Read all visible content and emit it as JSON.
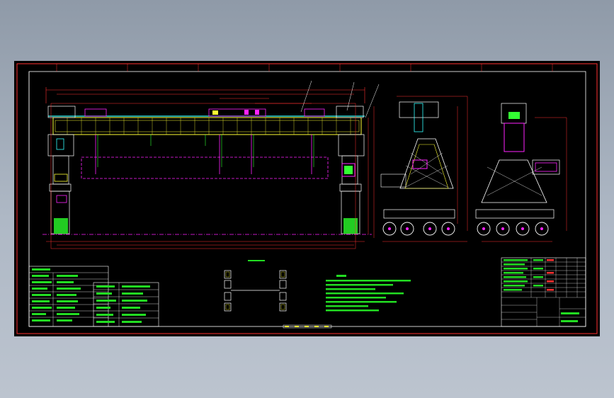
{
  "drawing": {
    "center_title": "",
    "notes_title": "",
    "bottom_label": "",
    "scale": "",
    "left_table_rows": [
      "",
      "",
      "",
      "",
      "",
      "",
      "",
      "",
      ""
    ],
    "mid_table_rows": [
      "",
      "",
      "",
      "",
      "",
      ""
    ],
    "notes_lines": [
      "",
      "",
      "",
      "",
      "",
      ""
    ],
    "title_block": {
      "code": "",
      "ratio": "",
      "name": ""
    }
  },
  "colors": {
    "frame": "#ffffff",
    "red": "#ff2020",
    "magenta": "#ff22ff",
    "yellow": "#ffff33",
    "cyan": "#33ffff",
    "green": "#33ff33",
    "white": "#ffffff"
  }
}
